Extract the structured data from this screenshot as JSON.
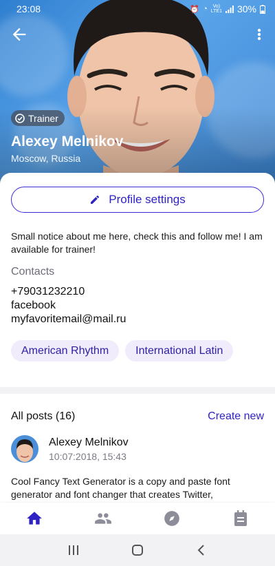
{
  "status_bar": {
    "time": "23:08",
    "network_top": "Vo)",
    "network_bottom": "LTE1",
    "battery": "30%"
  },
  "profile": {
    "role_badge": "Trainer",
    "name": "Alexey Melnikov",
    "location": "Moscow, Russia"
  },
  "card": {
    "settings_label": "Profile settings",
    "about": "Small notice about me here, check this and follow me! I am available for trainer!",
    "contacts_heading": "Contacts",
    "contacts": [
      "+79031232210",
      "facebook",
      "myfavoritemail@mail.ru"
    ],
    "tags": [
      "American Rhythm",
      "International Latin"
    ]
  },
  "posts": {
    "title": "All posts (16)",
    "create_label": "Create new",
    "item": {
      "author": "Alexey Melnikov",
      "date": "10:07:2018, 15:43",
      "text": "Cool Fancy Text Generator is a copy and paste font generator and font changer that creates Twitter,"
    }
  },
  "bottom_nav": [
    "home-icon",
    "people-icon",
    "compass-icon",
    "calendar-icon"
  ],
  "colors": {
    "accent": "#2f22c4",
    "tag_bg": "#f0ecfb",
    "inactive_icon": "#8d8d99"
  }
}
